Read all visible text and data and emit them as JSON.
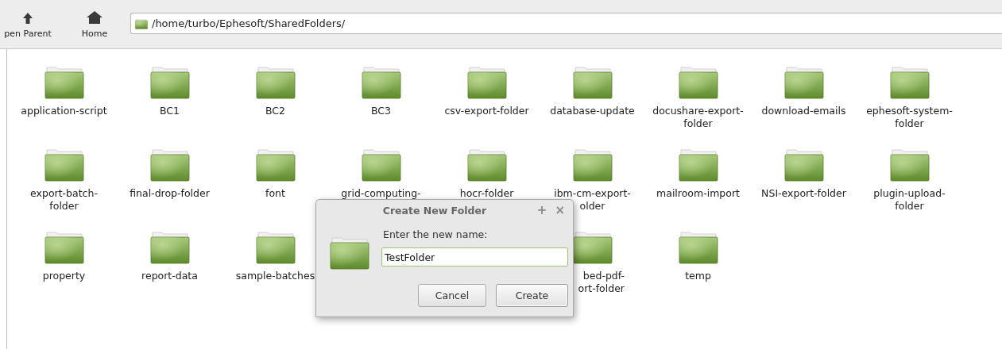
{
  "toolbar": {
    "buttons": [
      {
        "label": "pen Parent",
        "kind": "up"
      },
      {
        "label": "Home",
        "kind": "home"
      }
    ],
    "location": {
      "value": "/home/turbo/Ephesoft/SharedFolders/"
    }
  },
  "folders": [
    {
      "kind": "folder",
      "lines": [
        "application-script"
      ]
    },
    {
      "kind": "folder",
      "lines": [
        "BC1"
      ]
    },
    {
      "kind": "folder",
      "lines": [
        "BC2"
      ]
    },
    {
      "kind": "folder",
      "lines": [
        "BC3"
      ]
    },
    {
      "kind": "folder",
      "lines": [
        "csv-export-folder"
      ]
    },
    {
      "kind": "folder",
      "lines": [
        "database-update"
      ]
    },
    {
      "kind": "folder",
      "lines": [
        "docushare-export-",
        "folder"
      ]
    },
    {
      "kind": "folder",
      "lines": [
        "download-emails"
      ]
    },
    {
      "kind": "folder",
      "lines": [
        "ephesoft-system-",
        "folder"
      ]
    },
    {
      "kind": "folder",
      "lines": [
        "export-batch-",
        "folder"
      ]
    },
    {
      "kind": "folder",
      "lines": [
        "final-drop-folder"
      ]
    },
    {
      "kind": "folder",
      "lines": [
        "font"
      ]
    },
    {
      "kind": "folder",
      "lines": [
        "grid-computing-"
      ]
    },
    {
      "kind": "folder",
      "lines": [
        "hocr-folder"
      ]
    },
    {
      "kind": "folder",
      "lines": [
        "ibm-cm-export-",
        "older"
      ]
    },
    {
      "kind": "folder",
      "lines": [
        "mailroom-import"
      ]
    },
    {
      "kind": "folder",
      "lines": [
        "NSI-export-folder"
      ]
    },
    {
      "kind": "folder",
      "lines": [
        "plugin-upload-",
        "folder"
      ]
    },
    {
      "kind": "folder",
      "lines": [
        "property"
      ]
    },
    {
      "kind": "folder",
      "lines": [
        "report-data"
      ]
    },
    {
      "kind": "folder",
      "lines": [
        "sample-batches"
      ]
    },
    {
      "kind": "covered"
    },
    {
      "kind": "covered"
    },
    {
      "kind": "folder",
      "lines": [
        "bed-pdf-",
        "ort-folder"
      ],
      "cut_left": true
    },
    {
      "kind": "folder",
      "lines": [
        "temp"
      ]
    }
  ],
  "dialog": {
    "title": "Create New Folder",
    "prompt": "Enter the new name:",
    "input": {
      "value": "TestFolder"
    },
    "title_buttons": [
      "+",
      "×"
    ],
    "buttons": [
      {
        "label": "Cancel",
        "default": false
      },
      {
        "label": "Create",
        "default": true
      }
    ]
  }
}
